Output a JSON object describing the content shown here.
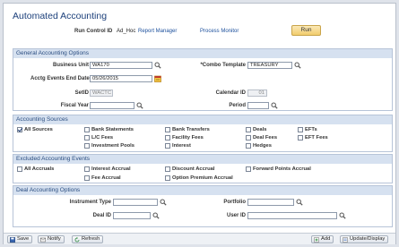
{
  "page": {
    "title": "Automated Accounting"
  },
  "run_bar": {
    "run_control_label": "Run Control ID",
    "run_control_value": "Ad_Hoc",
    "report_manager": "Report Manager",
    "process_monitor": "Process Monitor",
    "run_button": "Run"
  },
  "general": {
    "header": "General Accounting Options",
    "business_unit_label": "Business Unit",
    "business_unit_value": "WA170",
    "combo_template_label": "*Combo Template",
    "combo_template_value": "TREASURY",
    "acctg_end_date_label": "Acctg Events End Date",
    "acctg_end_date_value": "05/26/2015",
    "setid_label": "SetID",
    "setid_value": "WACTC",
    "calendar_id_label": "Calendar ID",
    "calendar_id_value": "01",
    "fiscal_year_label": "Fiscal Year",
    "fiscal_year_value": "",
    "period_label": "Period",
    "period_value": ""
  },
  "sources": {
    "header": "Accounting Sources",
    "items": [
      {
        "label": "All Sources",
        "checked": true
      },
      {
        "label": "Bank Statements",
        "checked": false
      },
      {
        "label": "Bank Transfers",
        "checked": false
      },
      {
        "label": "Deals",
        "checked": false
      },
      {
        "label": "EFTs",
        "checked": false
      },
      {
        "label": "L/C Fees",
        "checked": false
      },
      {
        "label": "Facility Fees",
        "checked": false
      },
      {
        "label": "Deal Fees",
        "checked": false
      },
      {
        "label": "EFT Fees",
        "checked": false
      },
      {
        "label": "Investment Pools",
        "checked": false
      },
      {
        "label": "Interest",
        "checked": false
      },
      {
        "label": "Hedges",
        "checked": false
      }
    ]
  },
  "events": {
    "header": "Excluded Accounting Events",
    "items": [
      {
        "label": "All Accruals",
        "checked": false
      },
      {
        "label": "Interest Accrual",
        "checked": false
      },
      {
        "label": "Discount Accrual",
        "checked": false
      },
      {
        "label": "Forward Points Accrual",
        "checked": false
      },
      {
        "label": "Fee Accrual",
        "checked": false
      },
      {
        "label": "Option Premium Accrual",
        "checked": false
      }
    ]
  },
  "deal": {
    "header": "Deal Accounting Options",
    "instrument_type_label": "Instrument Type",
    "instrument_type_value": "",
    "portfolio_label": "Portfolio",
    "portfolio_value": "",
    "deal_id_label": "Deal ID",
    "deal_id_value": "",
    "user_id_label": "User ID",
    "user_id_value": ""
  },
  "toolbar": {
    "save": "Save",
    "notify": "Notify",
    "refresh": "Refresh",
    "add": "Add",
    "update_display": "Update/Display"
  },
  "colors": {
    "section_header_bg": "#d6e1f0",
    "title_color": "#1b3f7a",
    "run_button_bg": "#f2cc6c"
  },
  "icons": {
    "lookup": "magnifier-icon",
    "calendar": "calendar-icon",
    "save": "save-icon",
    "notify": "notify-icon",
    "refresh": "refresh-icon",
    "add": "add-icon",
    "update": "update-display-icon"
  }
}
